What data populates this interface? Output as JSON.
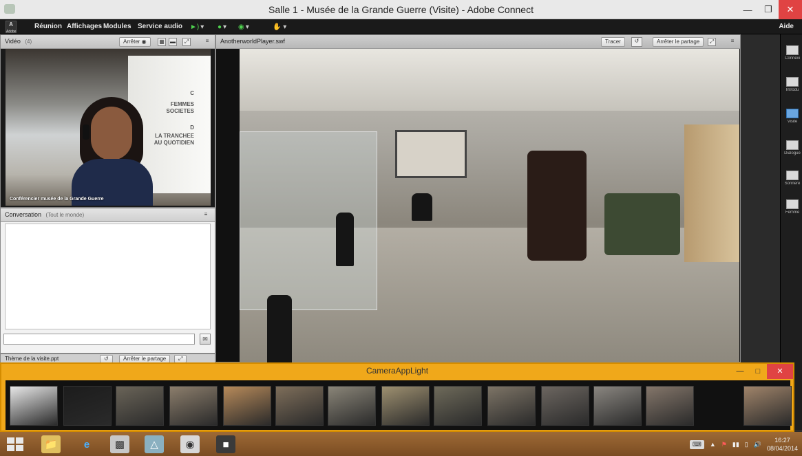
{
  "window": {
    "title": "Salle 1 - Musée de la Grande Guerre (Visite) - Adobe Connect"
  },
  "menubar": {
    "logo_text": "Adobe",
    "items": [
      "Réunion",
      "Affichages",
      "Modules",
      "Service audio"
    ],
    "help": "Aide"
  },
  "video_pod": {
    "title": "Vidéo",
    "count": "(4)",
    "stop_button": "Arrêter",
    "wall_text": [
      "C",
      "FEMMES",
      "SOCIETES",
      "D",
      "LA TRANCHEE",
      "AU QUOTIDIEN"
    ],
    "caption": "Conférencier musée de la Grande Guerre"
  },
  "chat_pod": {
    "title": "Conversation",
    "scope": "(Tout le monde)",
    "input_placeholder": ""
  },
  "ppt_pod": {
    "title": "Thème de la visite.ppt",
    "stop_share_button": "Arrêter le partage"
  },
  "share_pod": {
    "title": "AnotherworldPlayer.swf",
    "draw_button": "Tracer",
    "stop_share_button": "Arrêter le partage"
  },
  "rail": {
    "items": [
      {
        "label": "Connexi",
        "active": false
      },
      {
        "label": "Introdu",
        "active": false
      },
      {
        "label": "Visite",
        "active": true
      },
      {
        "label": "Dialogue",
        "active": false
      },
      {
        "label": "Sonnere",
        "active": false
      },
      {
        "label": "Femme",
        "active": false
      }
    ]
  },
  "camera_app": {
    "title": "CameraAppLight",
    "thumb_colors": [
      "#e8e8e8",
      "#1c1c1c",
      "#6a6458",
      "#8c7e6c",
      "#b78a5a",
      "#7e6e5a",
      "#8a8578",
      "#9e9070",
      "#6e6a5a",
      "#7d7466",
      "#6c6660",
      "#8a8680",
      "#84766a",
      "#a0846a"
    ]
  },
  "taskbar": {
    "time": "16:27",
    "date": "08/04/2014"
  },
  "colors": {
    "camapp_accent": "#f0a81a",
    "taskbar": "#9e6a36",
    "close_red": "#e04343",
    "rail_active": "#6aa6e0"
  }
}
